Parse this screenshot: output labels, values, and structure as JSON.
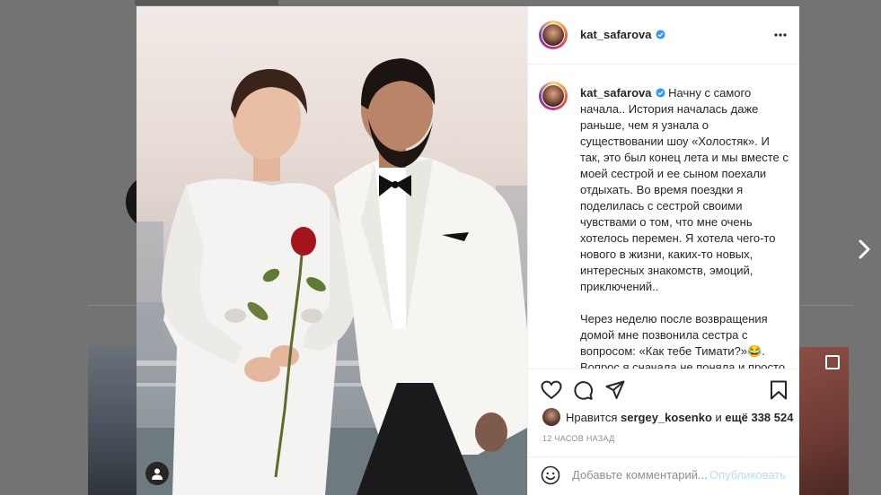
{
  "post": {
    "username": "kat_safarova",
    "verified": true,
    "caption": "Начну с самого начала.. История началась даже раньше, чем я узнала о существовании шоу «Холостяк». И так, это был конец лета и мы вместе с моей сестрой и ее сыном поехали отдыхать. Во время поездки я поделилась с сестрой своими чувствами о том, что мне очень хотелось перемен. Я хотела чего-то нового в жизни, каких-то новых, интересных знакомств, эмоций, приключений..\n\nЧерез неделю после возвращения домой мне позвонила сестра с вопросом: «Как тебе Тимати?»😂. Вопрос я сначала не поняла и просто рассмеялась со словами",
    "likes": {
      "prefix": "Нравится",
      "liker": "sergey_kosenko",
      "middle": "и",
      "others": "ещё 338 524"
    },
    "time_ago": "12 ЧАСОВ НАЗАД",
    "comment": {
      "placeholder": "Добавьте комментарий...",
      "post_label": "Опубликовать"
    }
  },
  "icons": {
    "heart": "heart-icon",
    "comment": "comment-icon",
    "share": "paper-plane-icon",
    "save": "bookmark-icon",
    "more": "more-icon",
    "emoji": "emoji-icon",
    "tag": "user-tag-icon",
    "next": "chevron-right-icon",
    "verified": "verified-badge-icon"
  },
  "colors": {
    "post_button_disabled": "#b2dffc",
    "verified_blue": "#3897f0",
    "muted_text": "#8e8e8e",
    "overlay": "#737373"
  }
}
